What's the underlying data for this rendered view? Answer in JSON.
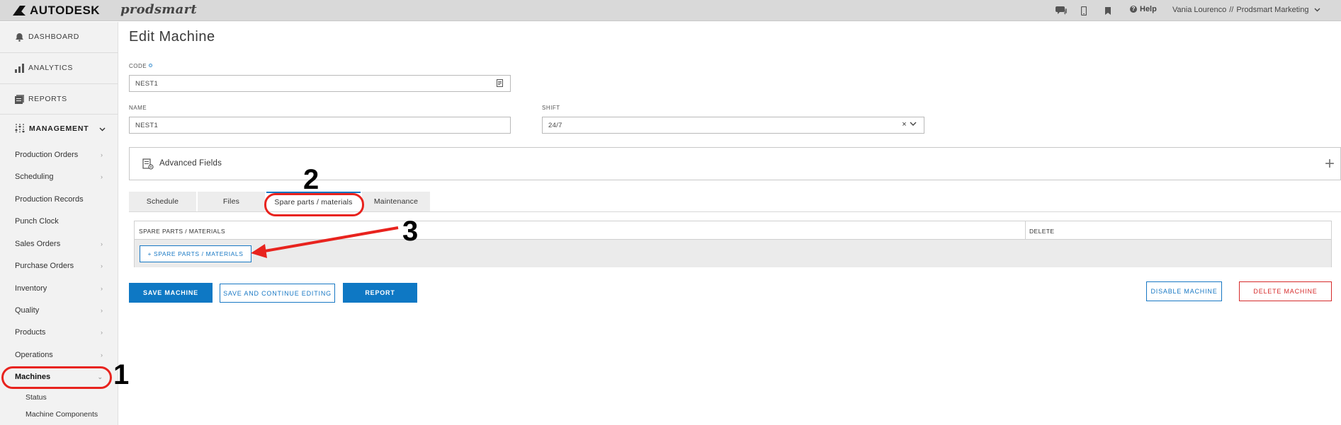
{
  "topbar": {
    "brand": "AUTODESK",
    "product": "prodsmart",
    "icons": [
      "chat-icon",
      "mobile-icon",
      "bookmark-icon"
    ],
    "help_label": "Help",
    "user_name": "Vania Lourenco",
    "user_separator": "//",
    "organization": "Prodsmart Marketing"
  },
  "sidebar": {
    "top_items": [
      {
        "label": "DASHBOARD",
        "icon": "bell-icon"
      },
      {
        "label": "ANALYTICS",
        "icon": "bar-chart-icon"
      },
      {
        "label": "REPORTS",
        "icon": "reports-icon"
      }
    ],
    "management_label": "MANAGEMENT",
    "items": [
      {
        "label": "Production Orders",
        "chevron": true
      },
      {
        "label": "Scheduling",
        "chevron": true
      },
      {
        "label": "Production Records",
        "chevron": false
      },
      {
        "label": "Punch Clock",
        "chevron": false
      },
      {
        "label": "Sales Orders",
        "chevron": true
      },
      {
        "label": "Purchase Orders",
        "chevron": true
      },
      {
        "label": "Inventory",
        "chevron": true
      },
      {
        "label": "Quality",
        "chevron": true
      },
      {
        "label": "Products",
        "chevron": true
      },
      {
        "label": "Operations",
        "chevron": true
      },
      {
        "label": "Machines",
        "chevron": true
      }
    ],
    "sub_items": [
      "Status",
      "Machine Components"
    ]
  },
  "form": {
    "title": "Edit Machine",
    "code_label": "CODE",
    "code_value": "NEST1",
    "name_label": "NAME",
    "name_value": "NEST1",
    "shift_label": "SHIFT",
    "shift_value": "24/7",
    "advanced_label": "Advanced Fields"
  },
  "tabs": [
    "Schedule",
    "Files",
    "Spare parts / materials",
    "Maintenance"
  ],
  "active_tab": "Spare parts / materials",
  "table": {
    "col_spare": "SPARE PARTS / MATERIALS",
    "col_delete": "DELETE",
    "add_button": "+ SPARE PARTS / MATERIALS"
  },
  "actions": {
    "save": "SAVE MACHINE",
    "save_continue": "SAVE AND CONTINUE EDITING",
    "report": "REPORT",
    "disable": "DISABLE MACHINE",
    "delete": "DELETE MACHINE"
  },
  "annotations": [
    "1",
    "2",
    "3"
  ],
  "colors": {
    "primary": "#0e78c4",
    "danger": "#d62b2b",
    "annotation": "#e8231e"
  }
}
